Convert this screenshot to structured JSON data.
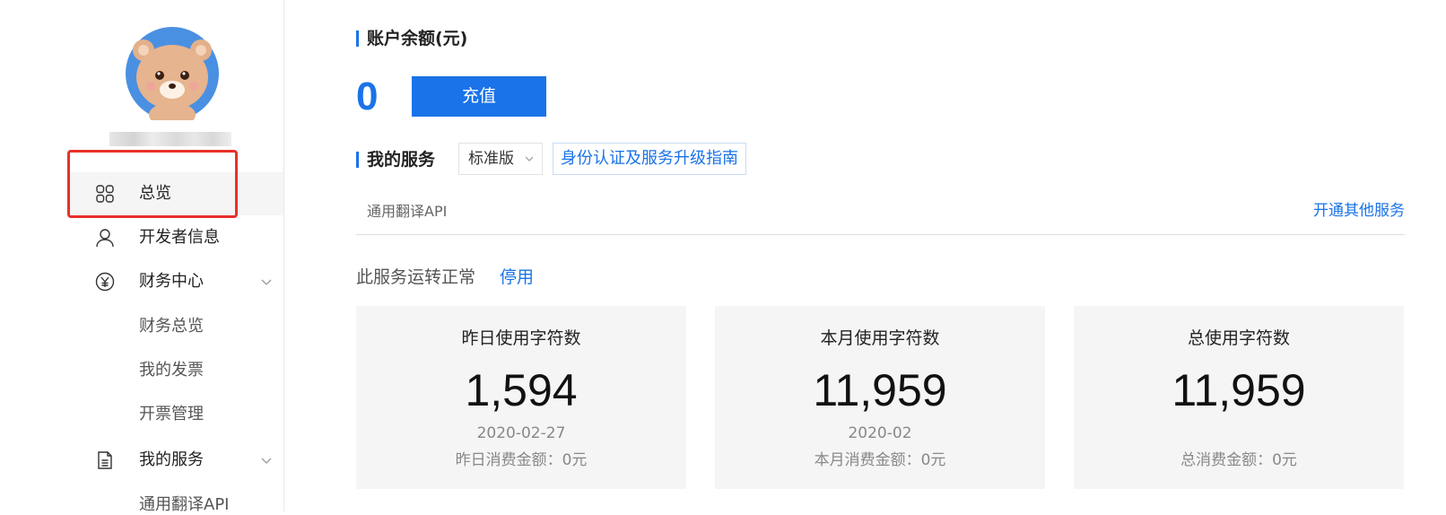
{
  "sidebar": {
    "nav": [
      {
        "label": "总览",
        "icon": "grid-icon",
        "active": true
      },
      {
        "label": "开发者信息",
        "icon": "user-icon"
      },
      {
        "label": "财务中心",
        "icon": "yen-icon",
        "expandable": true
      },
      {
        "label": "我的服务",
        "icon": "document-icon",
        "expandable": true
      }
    ],
    "finance_sub": [
      "财务总览",
      "我的发票",
      "开票管理"
    ],
    "services_sub": [
      "通用翻译API"
    ]
  },
  "balance": {
    "title": "账户余额(元)",
    "value": "0",
    "recharge_label": "充值"
  },
  "services": {
    "title": "我的服务",
    "plan_selected": "标准版",
    "guide_label": "身份认证及服务升级指南",
    "service_name": "通用翻译API",
    "open_other_label": "开通其他服务",
    "status_text": "此服务运转正常",
    "stop_label": "停用"
  },
  "stats": [
    {
      "title": "昨日使用字符数",
      "value": "1,594",
      "date": "2020-02-27",
      "fee": "昨日消费金额：0元"
    },
    {
      "title": "本月使用字符数",
      "value": "11,959",
      "date": "2020-02",
      "fee": "本月消费金额：0元"
    },
    {
      "title": "总使用字符数",
      "value": "11,959",
      "date": "",
      "fee": "总消费金额：0元"
    }
  ],
  "colors": {
    "accent": "#1a73e8",
    "highlight": "#e8312a",
    "card_bg": "#f5f5f5"
  }
}
